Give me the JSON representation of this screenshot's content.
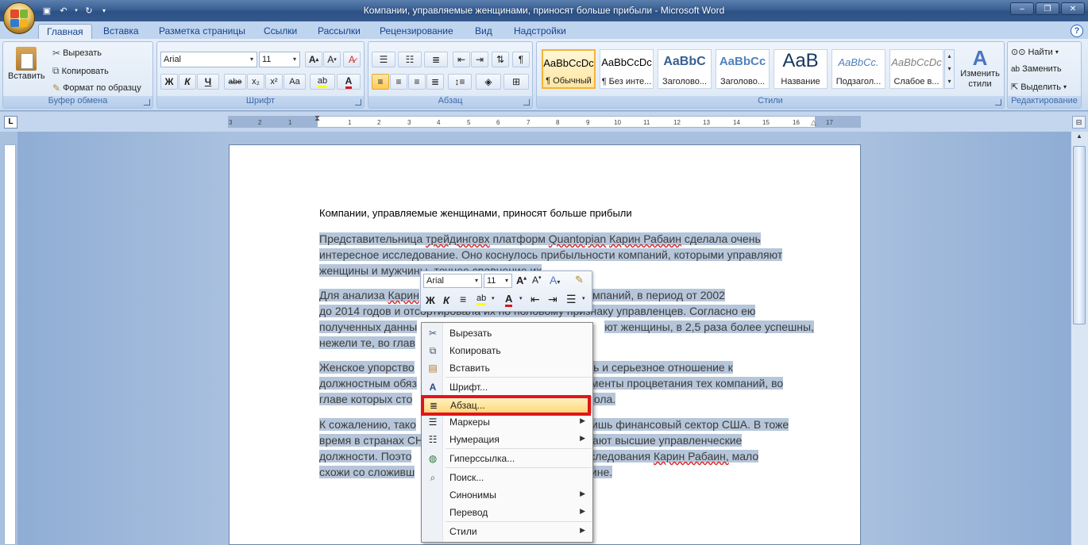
{
  "window": {
    "title": "Компании, управляемые женщинами, приносят больше прибыли - Microsoft Word",
    "qat": [
      "save-icon",
      "undo-icon",
      "redo-icon"
    ]
  },
  "tabs": [
    "Главная",
    "Вставка",
    "Разметка страницы",
    "Ссылки",
    "Рассылки",
    "Рецензирование",
    "Вид",
    "Надстройки"
  ],
  "ribbon": {
    "clipboard": {
      "paste": "Вставить",
      "cut": "Вырезать",
      "copy": "Копировать",
      "format_painter": "Формат по образцу",
      "label": "Буфер обмена"
    },
    "font": {
      "name": "Arial",
      "size": "11",
      "bold": "Ж",
      "italic": "К",
      "underline": "Ч",
      "strike": "abe",
      "sub": "x₂",
      "sup": "x²",
      "case": "Aa",
      "color_letter": "A",
      "label": "Шрифт"
    },
    "paragraph": {
      "label": "Абзац"
    },
    "styles": {
      "items": [
        {
          "preview": "AaBbCcDc",
          "name": "¶ Обычный"
        },
        {
          "preview": "AaBbCcDc",
          "name": "¶ Без инте..."
        },
        {
          "preview": "AaBbC",
          "name": "Заголово..."
        },
        {
          "preview": "AaBbCc",
          "name": "Заголово..."
        },
        {
          "preview": "AaB",
          "name": "Название"
        },
        {
          "preview": "AaBbCc.",
          "name": "Подзагол..."
        },
        {
          "preview": "AaBbCcDc",
          "name": "Слабое в..."
        }
      ],
      "change": "Изменить стили",
      "label": "Стили"
    },
    "editing": {
      "find": "Найти",
      "replace": "Заменить",
      "select": "Выделить",
      "label": "Редактирование"
    }
  },
  "ruler": {
    "ticks": [
      "3",
      "2",
      "1",
      "1",
      "2",
      "3",
      "4",
      "5",
      "6",
      "7",
      "8",
      "9",
      "10",
      "11",
      "12",
      "13",
      "14",
      "15",
      "16",
      "17"
    ]
  },
  "document": {
    "title": "Компании, управляемые женщинами, приносят больше прибыли",
    "p1a": "Представительница ",
    "p1b": "трейдинговх",
    "p1c": " платформ ",
    "p1d": "Quantopian",
    "p1e": " ",
    "p1f": "Карин Рабаин",
    "p1g": " сделала очень",
    "p1_line2": "интересное исследование. Оно коснулось прибыльности компаний, которыми управляют",
    "p1_line3": "женщины и мужчины, точнее сравнение их",
    "p2_line1a": "Для анализа ",
    "p2_line1b": "Карин",
    "p2_line1c": "их мировых компаний, в период от 2002",
    "p2_line2a": "до 2014 годов и отсортировала их по половому ",
    "p2_line2b": "признаку управленцев. Согласно ею",
    "p2_line3a": "полученных данны",
    "p2_line3b": "ют женщины, в 2,5 раза более успешны,",
    "p2_line4": "нежели те, во глав",
    "p3_line1a": "Женское упорство",
    "p3_line1b": "ть и серьезное отношение к",
    "p3_line2a": "должностным обяз",
    "p3_line2b": "менты процветания тех компаний, во",
    "p3_line3a": "главе которых сто",
    "p3_line3b": "пола.",
    "p4_line1a": "К сожалению, тако",
    "p4_line1b": "лишь финансовый сектор США. В тоже",
    "p4_line2a": "время в странах СН",
    "p4_line2b": "ают высшие управленческие",
    "p4_line3a": "должности.  Поэто",
    "p4_line3b": "исследования ",
    "p4_line3c": "Карин Рабаин,",
    "p4_line3d": " мало",
    "p4_line4a": "схожи со сложивш",
    "p4_line4b": "краине."
  },
  "mini_toolbar": {
    "font": "Arial",
    "size": "11",
    "bold": "Ж",
    "italic": "К",
    "color_letter": "A"
  },
  "context_menu": {
    "items": [
      {
        "label": "Вырезать",
        "icon": "scissors-icon"
      },
      {
        "label": "Копировать",
        "icon": "copy-icon"
      },
      {
        "label": "Вставить",
        "icon": "paste-icon"
      },
      {
        "label": "Шрифт...",
        "icon": "font-icon"
      },
      {
        "label": "Абзац...",
        "icon": "paragraph-icon"
      },
      {
        "label": "Маркеры",
        "icon": "bullets-icon"
      },
      {
        "label": "Нумерация",
        "icon": "numbering-icon"
      },
      {
        "label": "Гиперссылка...",
        "icon": "hyperlink-icon"
      },
      {
        "label": "Поиск...",
        "icon": "research-icon"
      },
      {
        "label": "Синонимы",
        "icon": ""
      },
      {
        "label": "Перевод",
        "icon": ""
      },
      {
        "label": "Стили",
        "icon": ""
      }
    ],
    "highlighted": "Абзац..."
  },
  "colors": {
    "accent": "#15428b",
    "highlight_box": "#e0141e",
    "selection": "#b6c6da"
  }
}
